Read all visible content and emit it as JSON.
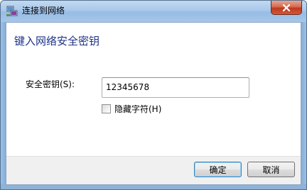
{
  "window": {
    "title": "连接到网络",
    "title_icon": "network-icon",
    "close_icon": "close-icon"
  },
  "dialog": {
    "heading": "键入网络安全密钥",
    "security_key": {
      "label": "安全密钥(S):",
      "value": "12345678"
    },
    "hide_characters": {
      "label": "隐藏字符(H)",
      "checked": false
    }
  },
  "buttons": {
    "ok": "确定",
    "cancel": "取消"
  }
}
